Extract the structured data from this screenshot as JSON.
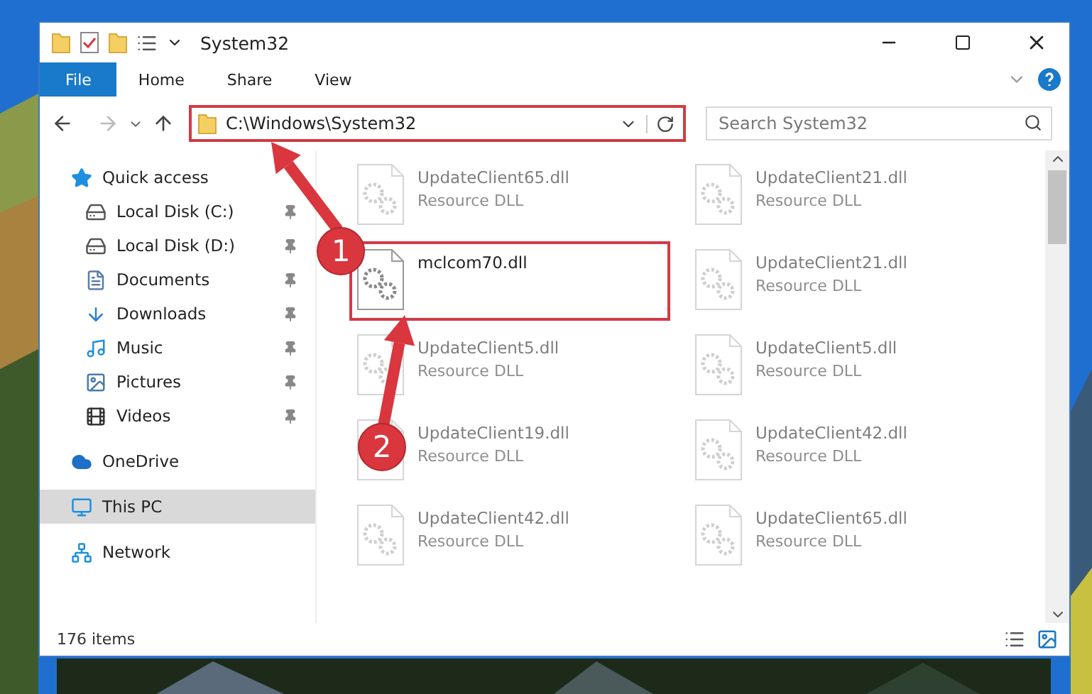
{
  "window": {
    "title": "System32"
  },
  "ribbon_tabs": [
    {
      "label": "File",
      "selected": true
    },
    {
      "label": "Home",
      "selected": false
    },
    {
      "label": "Share",
      "selected": false
    },
    {
      "label": "View",
      "selected": false
    }
  ],
  "address": {
    "path": "C:\\Windows\\System32",
    "highlighted": true
  },
  "search": {
    "placeholder": "Search System32"
  },
  "sidebar": {
    "items": [
      {
        "label": "Quick access",
        "selected": false,
        "children": [
          {
            "label": "Local Disk (C:)",
            "pinned": true,
            "selected": false
          },
          {
            "label": "Local Disk (D:)",
            "pinned": true,
            "selected": false
          },
          {
            "label": "Documents",
            "pinned": true,
            "selected": false
          },
          {
            "label": "Downloads",
            "pinned": true,
            "selected": false
          },
          {
            "label": "Music",
            "pinned": true,
            "selected": false
          },
          {
            "label": "Pictures",
            "pinned": true,
            "selected": false
          },
          {
            "label": "Videos",
            "pinned": true,
            "selected": false
          }
        ]
      },
      {
        "label": "OneDrive",
        "selected": false
      },
      {
        "label": "This PC",
        "selected": true
      },
      {
        "label": "Network",
        "selected": false
      }
    ]
  },
  "files": [
    {
      "name": "UpdateClient65.dll",
      "type": "Resource DLL",
      "blurred": true,
      "highlighted": false
    },
    {
      "name": "UpdateClient21.dll",
      "type": "Resource DLL",
      "blurred": true,
      "highlighted": false
    },
    {
      "name": "mclcom70.dll",
      "blurred": false,
      "highlighted": true
    },
    {
      "name": "UpdateClient21.dll",
      "type": "Resource DLL",
      "blurred": true,
      "highlighted": false
    },
    {
      "name": "UpdateClient5.dll",
      "type": "Resource DLL",
      "blurred": true,
      "highlighted": false
    },
    {
      "name": "UpdateClient5.dll",
      "type": "Resource DLL",
      "blurred": true,
      "highlighted": false
    },
    {
      "name": "UpdateClient19.dll",
      "type": "Resource DLL",
      "blurred": true,
      "highlighted": false
    },
    {
      "name": "UpdateClient42.dll",
      "type": "Resource DLL",
      "blurred": true,
      "highlighted": false
    },
    {
      "name": "UpdateClient42.dll",
      "type": "Resource DLL",
      "blurred": true,
      "highlighted": false
    },
    {
      "name": "UpdateClient65.dll",
      "type": "Resource DLL",
      "blurred": true,
      "highlighted": false
    }
  ],
  "callouts": [
    {
      "label": "1"
    },
    {
      "label": "2"
    }
  ],
  "status_bar": {
    "item_count": "176 items"
  }
}
